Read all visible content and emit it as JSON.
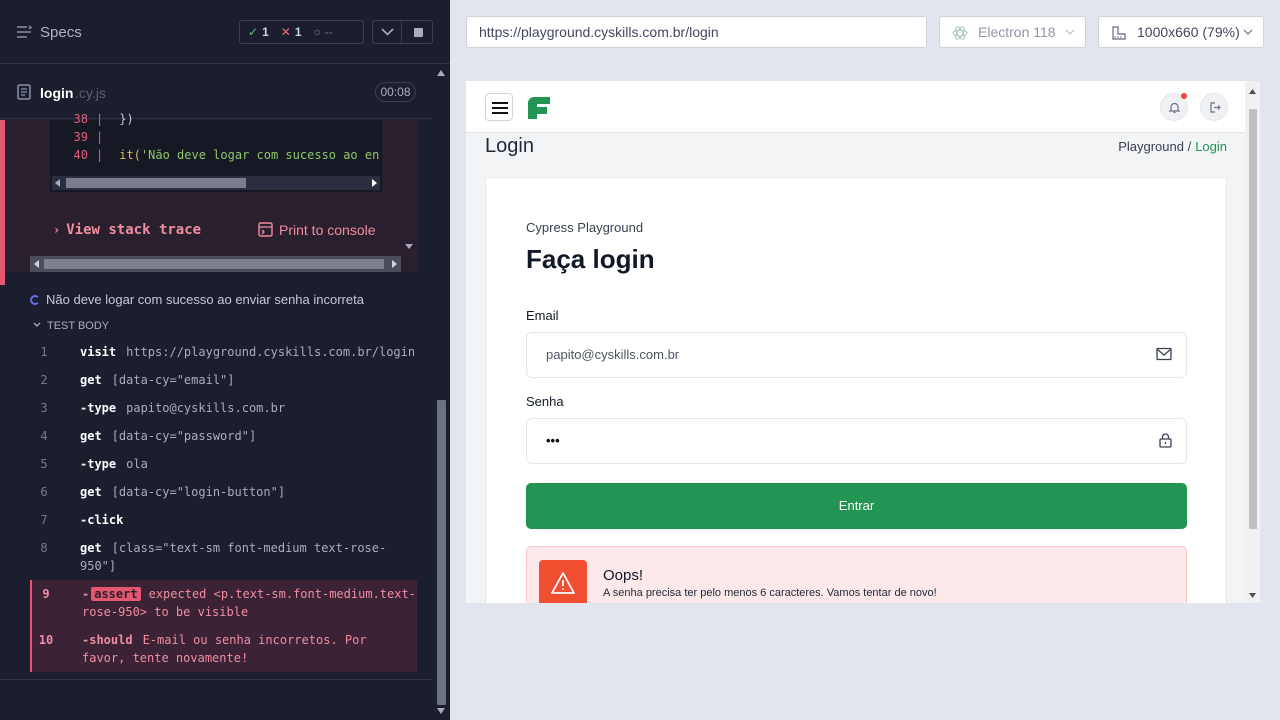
{
  "reporter": {
    "title": "Specs",
    "stats": {
      "passed": "1",
      "failed": "1",
      "pending": "--"
    },
    "file_name": "login",
    "file_ext": ".cy.js",
    "duration": "00:08"
  },
  "error": {
    "code_lines": [
      {
        "line": "38",
        "text": "})"
      },
      {
        "line": "39",
        "text": ""
      },
      {
        "line": "40",
        "kw": "it(",
        "str": "'Não deve logar com sucesso ao en"
      }
    ],
    "view_stack": "View stack trace",
    "print_console": "Print to console"
  },
  "running_test": "Não deve logar com sucesso ao enviar senha incorreta",
  "test_body_label": "TEST BODY",
  "commands": [
    {
      "n": "1",
      "name": "visit",
      "arg": "https://playground.cyskills.com.br/login"
    },
    {
      "n": "2",
      "name": "get",
      "arg": "[data-cy=\"email\"]"
    },
    {
      "n": "3",
      "name": "-type",
      "arg": "papito@cyskills.com.br"
    },
    {
      "n": "4",
      "name": "get",
      "arg": "[data-cy=\"password\"]"
    },
    {
      "n": "5",
      "name": "-type",
      "arg": "ola"
    },
    {
      "n": "6",
      "name": "get",
      "arg": "[data-cy=\"login-button\"]"
    },
    {
      "n": "7",
      "name": "-click",
      "arg": ""
    },
    {
      "n": "8",
      "name": "get",
      "arg": "[class=\"text-sm font-medium text-rose-950\"]"
    },
    {
      "n": "9",
      "name": "-",
      "badge": "assert",
      "arg": "expected <p.text-sm.font-medium.text-rose-950> to be visible"
    },
    {
      "n": "10",
      "name": "-should",
      "arg": "E-mail ou senha incorretos. Por favor, tente novamente!"
    }
  ],
  "browser": {
    "url": "https://playground.cyskills.com.br/login",
    "name": "Electron 118",
    "viewport": "1000x660  (79%)"
  },
  "aut": {
    "page_heading": "Login",
    "breadcrumb": {
      "root": "Playground /",
      "current": "Login"
    },
    "subtitle": "Cypress Playground",
    "title": "Faça login",
    "email_label": "Email",
    "email_value": "papito@cyskills.com.br",
    "password_label": "Senha",
    "password_value": "•••",
    "login_button": "Entrar",
    "alert_title": "Oops!",
    "alert_message": "A senha precisa ter pelo menos 6 caracteres. Vamos tentar de novo!"
  },
  "colors": {
    "accent_green": "#229553",
    "error_pink": "#e45770",
    "reporter_bg": "#1b1e2e"
  },
  "icons": [
    "menu-icon",
    "check-icon",
    "x-icon",
    "spinner-icon",
    "chevron-down-icon",
    "stop-icon",
    "document-icon",
    "electron-icon",
    "ruler-icon",
    "hamburger-icon",
    "bell-icon",
    "logout-icon",
    "mail-icon",
    "lock-icon",
    "warning-icon",
    "print-icon",
    "chevron-right-icon"
  ]
}
